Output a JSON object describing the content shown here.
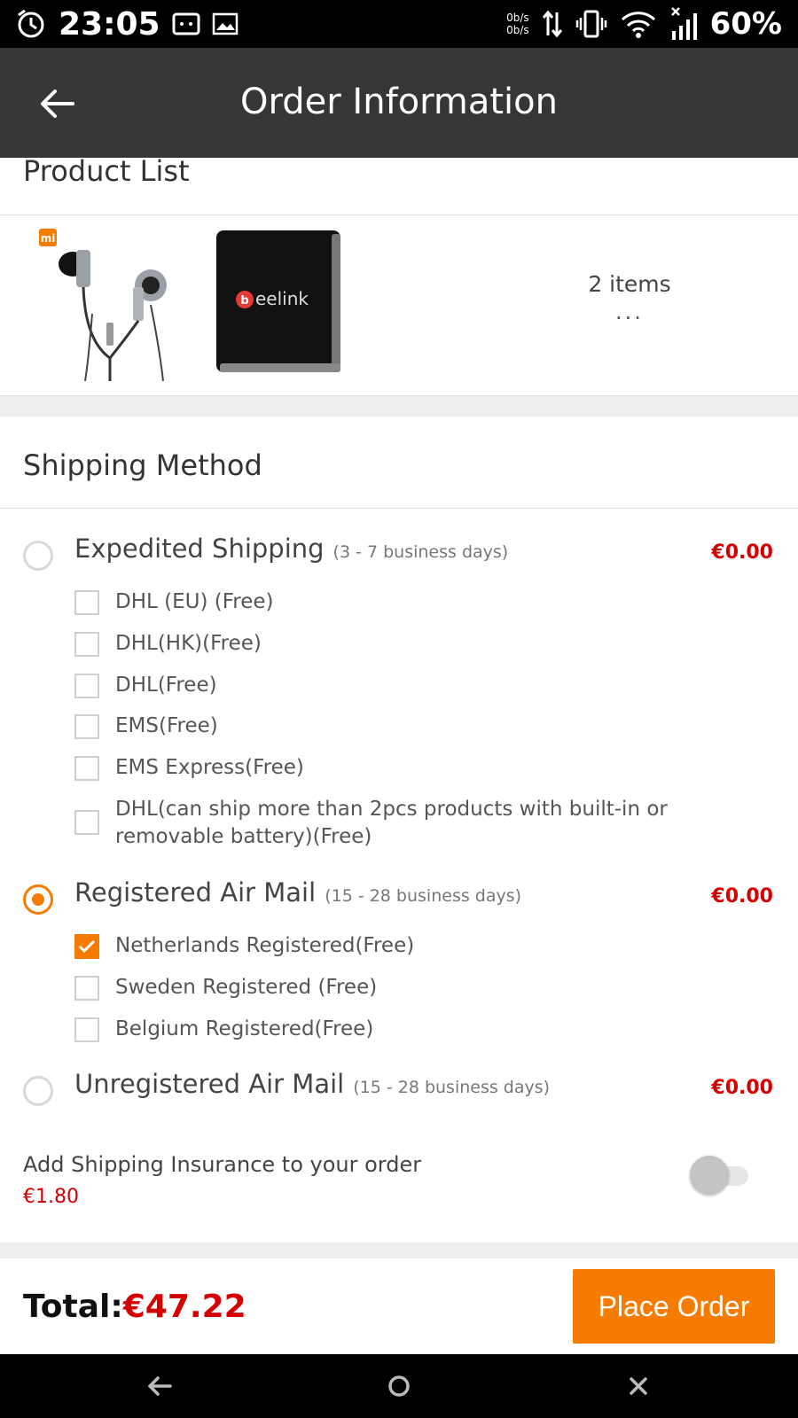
{
  "status_bar": {
    "time": "23:05",
    "battery": "60%",
    "speed_up": "0b/s",
    "speed_down": "0b/s"
  },
  "app_bar": {
    "title": "Order Information"
  },
  "product_list": {
    "title": "Product List",
    "thumb_brand": "mi",
    "thumb_box_brand": "eelink",
    "items_count": "2 items",
    "more": "..."
  },
  "shipping": {
    "title": "Shipping Method",
    "methods": [
      {
        "label": "Expedited Shipping",
        "days": "(3 - 7 business days)",
        "price": "€0.00",
        "selected": false,
        "options": [
          {
            "label": "DHL  (EU)  (Free)",
            "checked": false
          },
          {
            "label": "DHL(HK)(Free)",
            "checked": false
          },
          {
            "label": "DHL(Free)",
            "checked": false
          },
          {
            "label": "EMS(Free)",
            "checked": false
          },
          {
            "label": "EMS Express(Free)",
            "checked": false
          },
          {
            "label": "DHL(can ship more than 2pcs products with built-in or removable battery)(Free)",
            "checked": false
          }
        ]
      },
      {
        "label": "Registered Air Mail",
        "days": "(15 - 28 business days)",
        "price": "€0.00",
        "selected": true,
        "options": [
          {
            "label": "Netherlands Registered(Free)",
            "checked": true
          },
          {
            "label": "Sweden  Registered (Free)",
            "checked": false
          },
          {
            "label": "Belgium Registered(Free)",
            "checked": false
          }
        ]
      },
      {
        "label": "Unregistered Air Mail",
        "days": "(15 - 28 business days)",
        "price": "€0.00",
        "selected": false,
        "options": []
      }
    ],
    "insurance": {
      "label": "Add Shipping Insurance to your order",
      "price": "€1.80",
      "enabled": false
    }
  },
  "footer": {
    "total_label": "Total:",
    "total_amount": "€47.22",
    "place_order": "Place Order"
  },
  "colors": {
    "accent": "#f57c00",
    "price": "#d50000",
    "app_bar": "#363636"
  }
}
